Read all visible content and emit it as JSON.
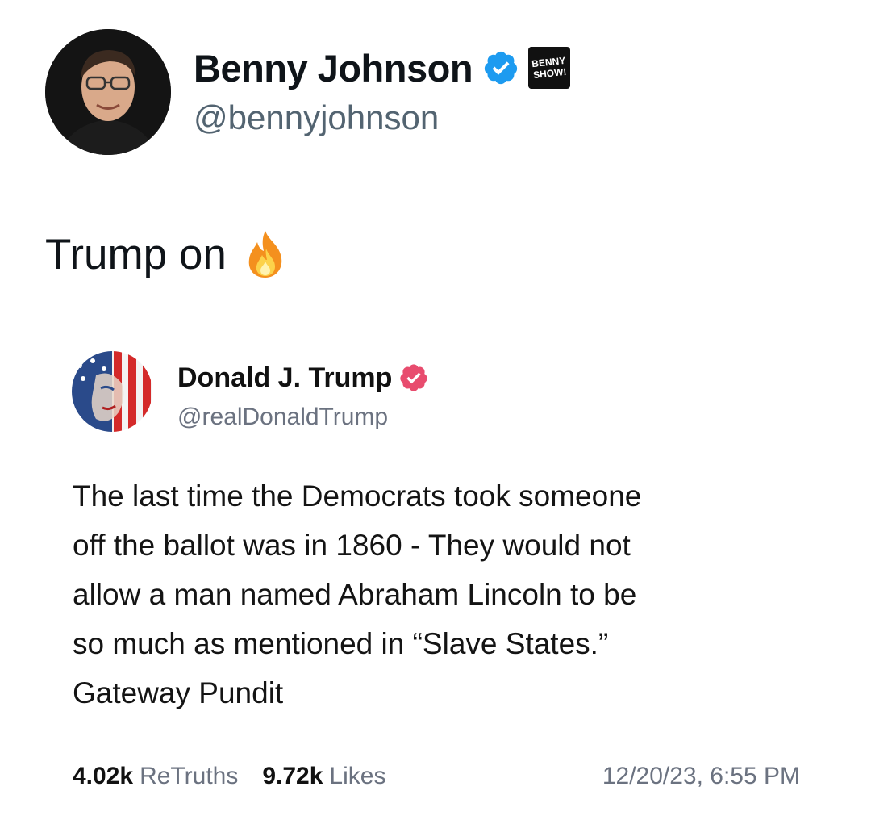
{
  "outer_post": {
    "author_name": "Benny Johnson",
    "author_handle": "@bennyjohnson",
    "badge_text": "BENNY SHOW!",
    "text": "Trump on",
    "emoji": "fire-emoji"
  },
  "embedded_post": {
    "author_name": "Donald J. Trump",
    "author_handle": "@realDonaldTrump",
    "body_lines": [
      "The last time the Democrats took someone",
      "off the ballot was in 1860 - They would not",
      "allow a man named Abraham Lincoln to be",
      "so much as mentioned in “Slave States.”",
      "Gateway Pundit"
    ],
    "retruths_count": "4.02k",
    "retruths_label": "ReTruths",
    "likes_count": "9.72k",
    "likes_label": "Likes",
    "timestamp": "12/20/23, 6:55 PM"
  },
  "colors": {
    "verified_blue": "#1d9bf0",
    "verified_pink": "#e84c6e",
    "secondary_text": "#536471"
  }
}
